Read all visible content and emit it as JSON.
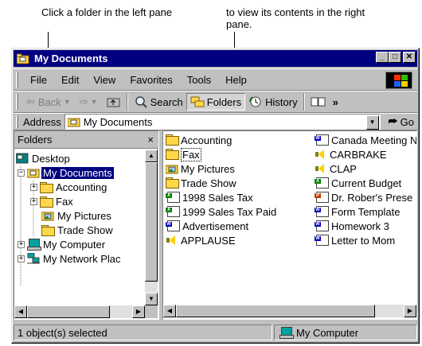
{
  "callouts": {
    "left": "Click a folder in the left pane",
    "right": "to view its contents in the right pane."
  },
  "window": {
    "title": "My Documents",
    "title_buttons": {
      "minimize": "_",
      "maximize": "□",
      "close": "✕"
    }
  },
  "menu": [
    "File",
    "Edit",
    "View",
    "Favorites",
    "Tools",
    "Help"
  ],
  "toolbar": {
    "back": "Back",
    "search": "Search",
    "folders": "Folders",
    "history": "History",
    "overflow": "»"
  },
  "address": {
    "label": "Address",
    "value": "My Documents",
    "go": "Go"
  },
  "folders_pane": {
    "title": "Folders",
    "close": "×",
    "tree": [
      {
        "label": "Desktop",
        "icon": "desktop-icon",
        "level": 0,
        "expander": ""
      },
      {
        "label": "My Documents",
        "icon": "my-documents-icon",
        "level": 1,
        "expander": "−",
        "selected": true
      },
      {
        "label": "Accounting",
        "icon": "folder-icon",
        "level": 2,
        "expander": "+"
      },
      {
        "label": "Fax",
        "icon": "folder-icon",
        "level": 2,
        "expander": "+"
      },
      {
        "label": "My Pictures",
        "icon": "pictures-folder-icon",
        "level": 2,
        "expander": ""
      },
      {
        "label": "Trade Show",
        "icon": "folder-icon",
        "level": 2,
        "expander": ""
      },
      {
        "label": "My Computer",
        "icon": "computer-icon",
        "level": 0,
        "expander": "+"
      },
      {
        "label": "My Network Plac",
        "icon": "network-icon",
        "level": 0,
        "expander": "+"
      }
    ]
  },
  "files": {
    "column1": [
      {
        "name": "Accounting",
        "icon": "folder-icon"
      },
      {
        "name": "Fax",
        "icon": "folder-icon"
      },
      {
        "name": "My Pictures",
        "icon": "pictures-folder-icon"
      },
      {
        "name": "Trade Show",
        "icon": "folder-icon"
      },
      {
        "name": "1998 Sales Tax",
        "icon": "excel-doc-icon"
      },
      {
        "name": "1999 Sales Tax Paid",
        "icon": "excel-doc-icon"
      },
      {
        "name": "Advertisement",
        "icon": "word-doc-icon"
      },
      {
        "name": "APPLAUSE",
        "icon": "sound-icon"
      }
    ],
    "column2": [
      {
        "name": "Canada Meeting N",
        "icon": "word-doc-icon"
      },
      {
        "name": "CARBRAKE",
        "icon": "sound-icon"
      },
      {
        "name": "CLAP",
        "icon": "sound-icon"
      },
      {
        "name": "Current Budget",
        "icon": "excel-doc-icon"
      },
      {
        "name": "Dr. Rober's Prese",
        "icon": "presentation-icon"
      },
      {
        "name": "Form Template",
        "icon": "word-doc-icon"
      },
      {
        "name": "Homework 3",
        "icon": "word-doc-icon"
      },
      {
        "name": "Letter to Mom",
        "icon": "word-doc-icon"
      }
    ]
  },
  "status": {
    "left": "1 object(s) selected",
    "right": "My Computer"
  },
  "colors": {
    "title_bar": "#000080",
    "face": "#c0c0c0",
    "selection": "#000080",
    "folder": "#ffd84a"
  }
}
